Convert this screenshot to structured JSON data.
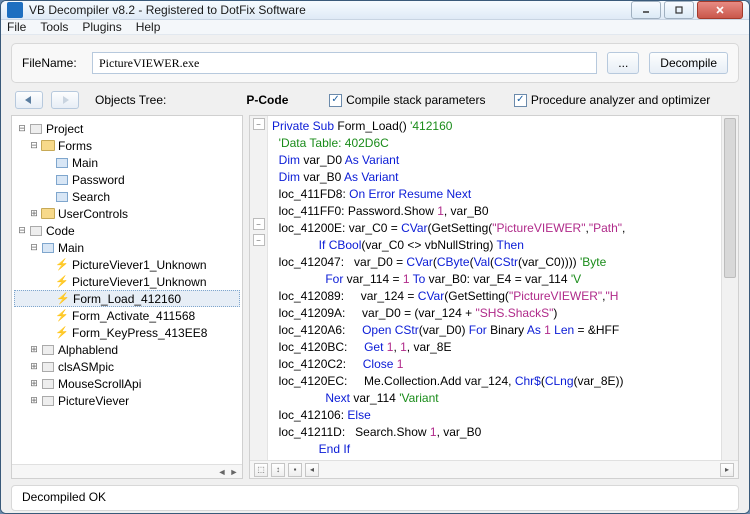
{
  "window": {
    "title": "VB Decompiler v8.2 - Registered to DotFix Software"
  },
  "menu": {
    "file": "File",
    "tools": "Tools",
    "plugins": "Plugins",
    "help": "Help"
  },
  "filerow": {
    "label": "FileName:",
    "value": "PictureVIEWER.exe",
    "browse": "...",
    "decompile": "Decompile"
  },
  "row2": {
    "objects_tree": "Objects Tree:",
    "pcode": "P-Code",
    "cb1": "Compile stack parameters",
    "cb2": "Procedure analyzer and optimizer"
  },
  "tree": {
    "project": "Project",
    "forms": "Forms",
    "form_items": [
      "Main",
      "Password",
      "Search"
    ],
    "usercontrols": "UserControls",
    "code": "Code",
    "main": "Main",
    "events": [
      "PictureViever1_Unknown",
      "PictureViever1_Unknown",
      "Form_Load_412160",
      "Form_Activate_411568",
      "Form_KeyPress_413EE8"
    ],
    "mods": [
      "Alphablend",
      "clsASMpic",
      "MouseScrollApi",
      "PictureViever"
    ]
  },
  "code": {
    "l1_a": "Private Sub",
    "l1_b": " Form_Load() ",
    "l1_c": "'412160",
    "l2": "  'Data Table: 402D6C",
    "l3_a": "  Dim",
    "l3_b": " var_D0 ",
    "l3_c": "As Variant",
    "l4_a": "  Dim",
    "l4_b": " var_B0 ",
    "l4_c": "As Variant",
    "l5_a": "  loc_411FD8: ",
    "l5_b": "On Error Resume Next",
    "l6_a": "  loc_411FF0: Password.Show ",
    "l6_b": "1",
    "l6_c": ", var_B0",
    "l7_a": "  loc_41200E: var_C0 = ",
    "l7_b": "CVar",
    "l7_c": "(GetSetting(",
    "l7_d": "\"PictureVIEWER\"",
    "l7_e": ",",
    "l7_f": "\"Path\"",
    "l7_g": ",",
    "l8_a": "              If ",
    "l8_b": "CBool",
    "l8_c": "(var_C0 <> vbNullString) ",
    "l8_d": "Then",
    "l9_a": "  loc_412047:   var_D0 = ",
    "l9_b": "CVar",
    "l9_c": "(",
    "l9_d": "CByte",
    "l9_e": "(",
    "l9_f": "Val",
    "l9_g": "(",
    "l9_h": "CStr",
    "l9_i": "(var_C0)))) ",
    "l9_j": "'Byte",
    "l10_a": "                For",
    "l10_b": " var_114 = ",
    "l10_c": "1",
    "l10_d": " To",
    "l10_e": " var_B0: var_E4 = var_114 ",
    "l10_f": "'V",
    "l11_a": "  loc_412089:     var_124 = ",
    "l11_b": "CVar",
    "l11_c": "(GetSetting(",
    "l11_d": "\"PictureVIEWER\"",
    "l11_e": ",",
    "l11_f": "\"H",
    "l12_a": "  loc_41209A:     var_D0 = (var_124 + ",
    "l12_b": "\"SHS.ShackS\"",
    "l12_c": ")",
    "l13_a": "  loc_4120A6:     ",
    "l13_b": "Open ",
    "l13_c": "CStr",
    "l13_d": "(var_D0) ",
    "l13_e": "For",
    "l13_f": " Binary ",
    "l13_g": "As ",
    "l13_h": "1",
    "l13_i": " Len",
    "l13_j": " = &HFF",
    "l14_a": "  loc_4120BC:     ",
    "l14_b": "Get ",
    "l14_c": "1",
    "l14_d": ", ",
    "l14_e": "1",
    "l14_f": ", var_8E",
    "l15_a": "  loc_4120C2:     ",
    "l15_b": "Close ",
    "l15_c": "1",
    "l16_a": "  loc_4120EC:     Me.Collection.Add var_124, ",
    "l16_b": "Chr$",
    "l16_c": "(",
    "l16_d": "CLng",
    "l16_e": "(var_8E))",
    "l17_a": "                Next",
    "l17_b": " var_114 ",
    "l17_c": "'Variant",
    "l18_a": "  loc_412106: ",
    "l18_b": "Else",
    "l19_a": "  loc_41211D:   Search.Show ",
    "l19_b": "1",
    "l19_c": ", var_B0",
    "l20": "              End If"
  },
  "status": "Decompiled OK"
}
